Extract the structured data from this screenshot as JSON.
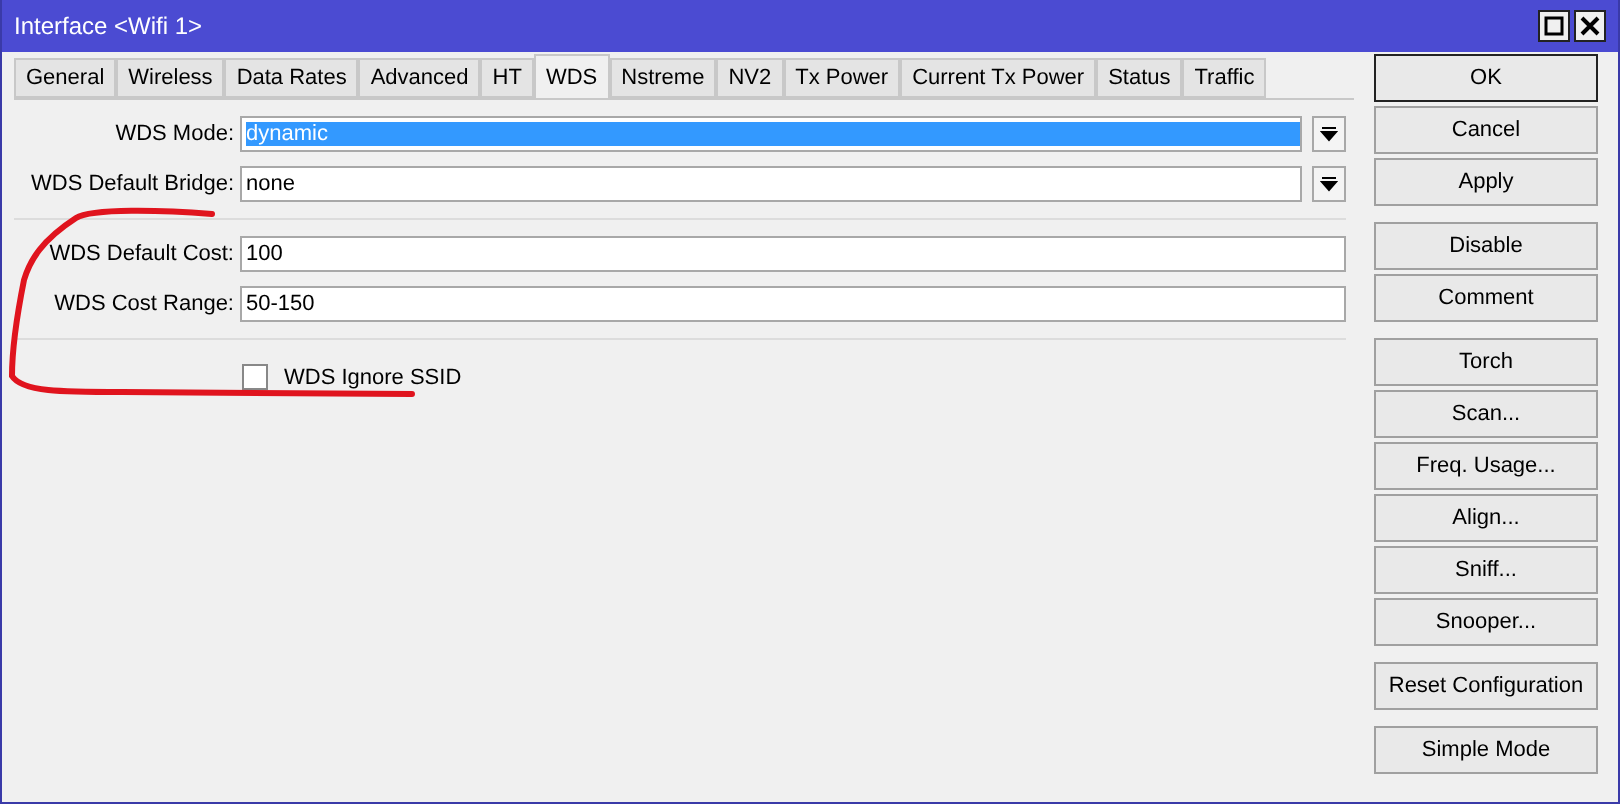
{
  "window": {
    "title": "Interface <Wifi 1>"
  },
  "tabs": [
    {
      "label": "General",
      "selected": false
    },
    {
      "label": "Wireless",
      "selected": false
    },
    {
      "label": "Data Rates",
      "selected": false
    },
    {
      "label": "Advanced",
      "selected": false
    },
    {
      "label": "HT",
      "selected": false
    },
    {
      "label": "WDS",
      "selected": true
    },
    {
      "label": "Nstreme",
      "selected": false
    },
    {
      "label": "NV2",
      "selected": false
    },
    {
      "label": "Tx Power",
      "selected": false
    },
    {
      "label": "Current Tx Power",
      "selected": false
    },
    {
      "label": "Status",
      "selected": false
    },
    {
      "label": "Traffic",
      "selected": false
    }
  ],
  "sections": [
    [
      {
        "kind": "dropdown",
        "label": "WDS Mode:",
        "value": "dynamic",
        "highlighted": true
      },
      {
        "kind": "dropdown",
        "label": "WDS Default Bridge:",
        "value": "none",
        "highlighted": false
      }
    ],
    [
      {
        "kind": "text",
        "label": "WDS Default Cost:",
        "value": "100"
      },
      {
        "kind": "text",
        "label": "WDS Cost Range:",
        "value": "50-150"
      }
    ],
    [
      {
        "kind": "checkbox",
        "label": "WDS Ignore SSID",
        "checked": false
      }
    ]
  ],
  "button_groups": [
    [
      "OK",
      "Cancel",
      "Apply"
    ],
    [
      "Disable",
      "Comment"
    ],
    [
      "Torch",
      "Scan...",
      "Freq. Usage...",
      "Align...",
      "Sniff...",
      "Snooper..."
    ],
    [
      "Reset Configuration"
    ],
    [
      "Simple Mode"
    ]
  ]
}
